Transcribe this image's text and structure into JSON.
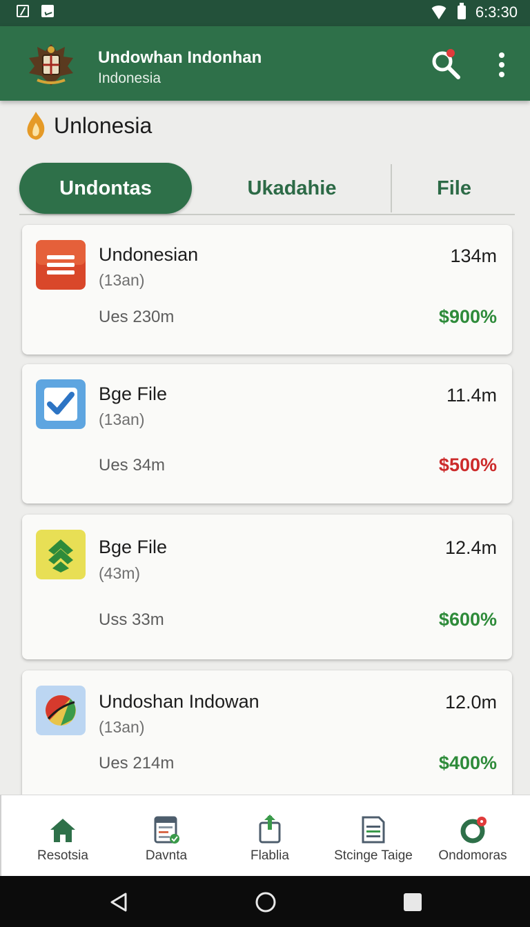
{
  "status_bar": {
    "time": "6:3:30"
  },
  "app_bar": {
    "title": "Undowhan Indonhan",
    "subtitle": "Indonesia"
  },
  "section": {
    "title": "Unlonesia"
  },
  "tabs": [
    {
      "label": "Undontas",
      "active": true
    },
    {
      "label": "Ukadahie",
      "active": false
    },
    {
      "label": "File",
      "active": false
    }
  ],
  "cards": [
    {
      "name": "Undonesian",
      "sub": "(13an)",
      "size": "134m",
      "usage": "Ues 230m",
      "change": "$900%",
      "trend": "up",
      "icon": "document-list-icon",
      "color": "#2e8b3a"
    },
    {
      "name": "Bge File",
      "sub": "(13an)",
      "size": "11.4m",
      "usage": "Ues 34m",
      "change": "$500%",
      "trend": "down",
      "icon": "checkbox-icon",
      "color": "#cc2b2b"
    },
    {
      "name": "Bge File",
      "sub": "(43m)",
      "size": "12.4m",
      "usage": "Uss 33m",
      "change": "$600%",
      "trend": "up",
      "icon": "chevron-stack-icon",
      "color": "#2e8b3a"
    },
    {
      "name": "Undoshan Indowan",
      "sub": "(13an)",
      "size": "12.0m",
      "usage": "Ues 214m",
      "change": "$400%",
      "trend": "up",
      "icon": "globe-icon",
      "color": "#2e8b3a"
    }
  ],
  "bottom_nav": [
    {
      "label": "Resotsia",
      "icon": "home-icon"
    },
    {
      "label": "Davnta",
      "icon": "report-icon"
    },
    {
      "label": "Flablia",
      "icon": "upload-icon"
    },
    {
      "label": "Stcinge Taige",
      "icon": "receipt-icon"
    },
    {
      "label": "Ondomoras",
      "icon": "refresh-notification-icon"
    }
  ],
  "colors": {
    "primary": "#2e7049",
    "status_bar": "#23513a",
    "positive": "#2e8b3a",
    "negative": "#cc2b2b"
  }
}
